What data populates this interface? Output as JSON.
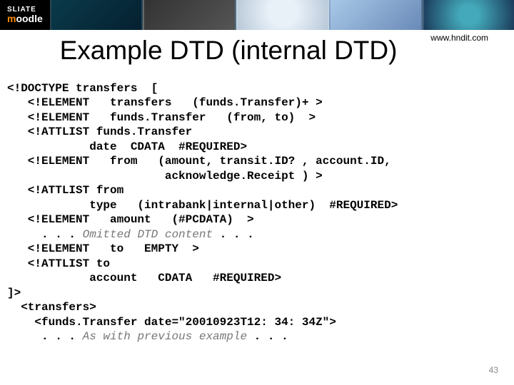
{
  "banner": {
    "logo_line1": "SLIATE",
    "logo_m": "m",
    "logo_oodle": "oodle"
  },
  "url": "www.hndit.com",
  "title": "Example DTD (internal DTD)",
  "code": {
    "l01": "<!DOCTYPE transfers  [",
    "l02": "   <!ELEMENT   transfers   (funds.Transfer)+ >",
    "l03": "   <!ELEMENT   funds.Transfer   (from, to)  >",
    "l04": "   <!ATTLIST funds.Transfer",
    "l05": "            date  CDATA  #REQUIRED>",
    "l06": "   <!ELEMENT   from   (amount, transit.ID? , account.ID,",
    "l07": "                       acknowledge.Receipt ) >",
    "l08": "   <!ATTLIST from",
    "l09": "            type   (intrabank|internal|other)  #REQUIRED>",
    "l10": "   <!ELEMENT   amount   (#PCDATA)  >",
    "l11a": "     . . . ",
    "l11b": "Omitted DTD content",
    "l11c": " . . .",
    "l12": "   <!ELEMENT   to   EMPTY  >",
    "l13": "   <!ATTLIST to",
    "l14": "            account   CDATA   #REQUIRED>",
    "l15": "]>",
    "l16": "  <transfers>",
    "l17": "    <funds.Transfer date=\"20010923T12: 34: 34Z\">",
    "l18a": "     . . . ",
    "l18b": "As with previous example",
    "l18c": " . . ."
  },
  "pagenum": "43"
}
